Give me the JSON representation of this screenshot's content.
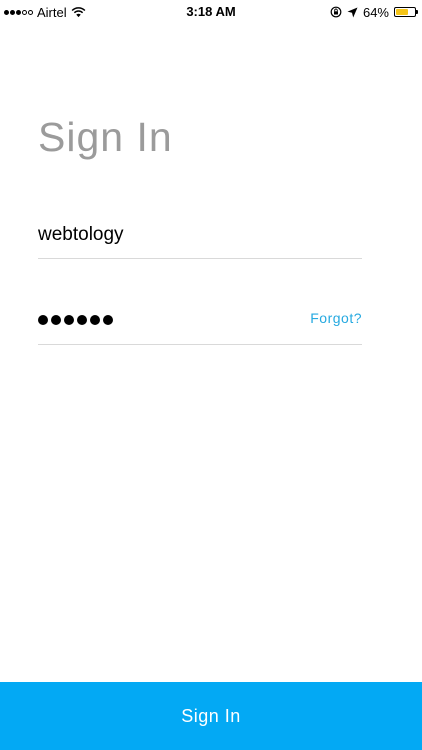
{
  "status_bar": {
    "carrier": "Airtel",
    "time": "3:18 AM",
    "battery": "64%",
    "battery_level": 0.64,
    "signal_bars_filled": 3,
    "signal_bars_total": 5,
    "icons": [
      "signal-icon",
      "wifi-icon",
      "orientation-lock-icon",
      "location-arrow-icon",
      "battery-icon"
    ],
    "battery_color": "#f5c518"
  },
  "login": {
    "title": "Sign In",
    "username_value": "webtology",
    "password_dot_count": 6,
    "forgot_label": "Forgot?",
    "submit_label": "Sign In"
  },
  "colors": {
    "accent": "#03a9f4",
    "link": "#26a9e0",
    "title": "#9b9b9b",
    "divider": "#d9d9d9"
  }
}
